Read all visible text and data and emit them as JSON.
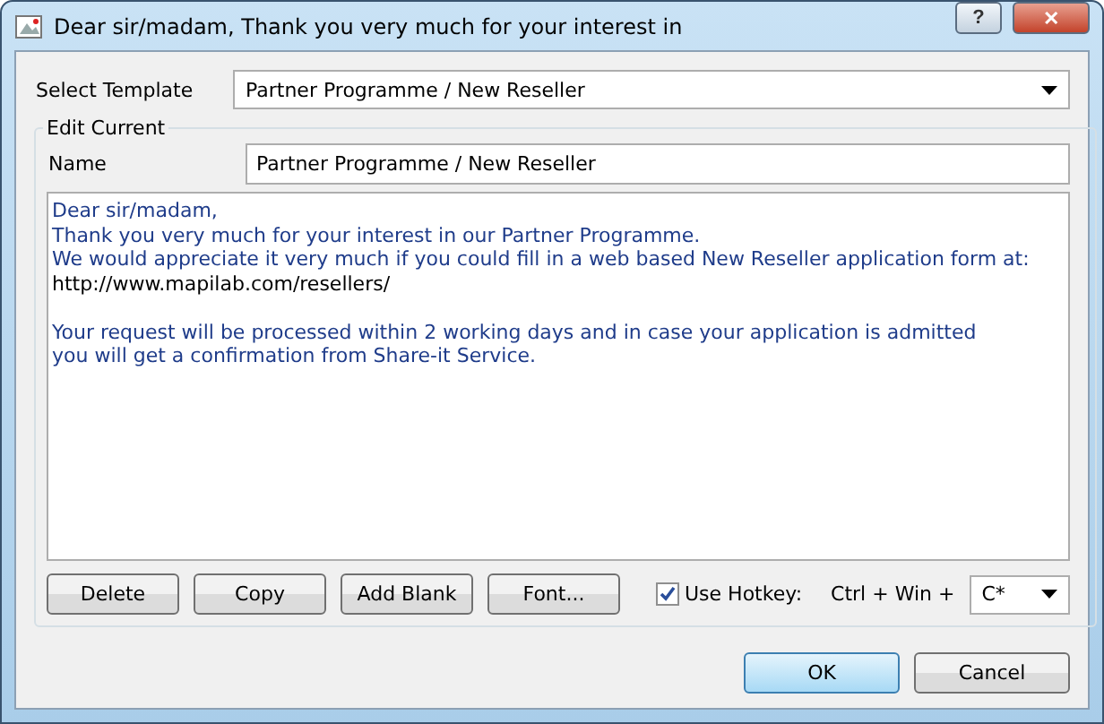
{
  "window": {
    "title": "Dear sir/madam, Thank you very much for your interest in",
    "help": "?",
    "close": "✕"
  },
  "select_template": {
    "label": "Select Template",
    "value": "Partner Programme / New Reseller"
  },
  "edit_current": {
    "title": "Edit Current",
    "name_label": "Name",
    "name_value": "Partner Programme / New Reseller",
    "body": [
      {
        "kind": "text",
        "text": "Dear sir/madam,"
      },
      {
        "kind": "text",
        "text": "Thank you very much for your interest in our Partner Programme."
      },
      {
        "kind": "text",
        "text": "We would appreciate it very much if you could fill in a web based New Reseller application form at:"
      },
      {
        "kind": "url",
        "text": "http://www.mapilab.com/resellers/"
      },
      {
        "kind": "blank"
      },
      {
        "kind": "text",
        "text": "Your request will be processed within 2 working days and in case your application is admitted"
      },
      {
        "kind": "text",
        "text": "you will get a confirmation from Share-it Service."
      }
    ],
    "buttons": [
      "Delete",
      "Copy",
      "Add Blank",
      "Font..."
    ],
    "use_hotkey": {
      "label": "Use Hotkey:",
      "checked": true
    },
    "hotkey_prefix": "Ctrl + Win +",
    "hotkey_key": "C*"
  },
  "buttons": [
    {
      "label": "OK",
      "default": true
    },
    {
      "label": "Cancel",
      "default": false
    }
  ]
}
